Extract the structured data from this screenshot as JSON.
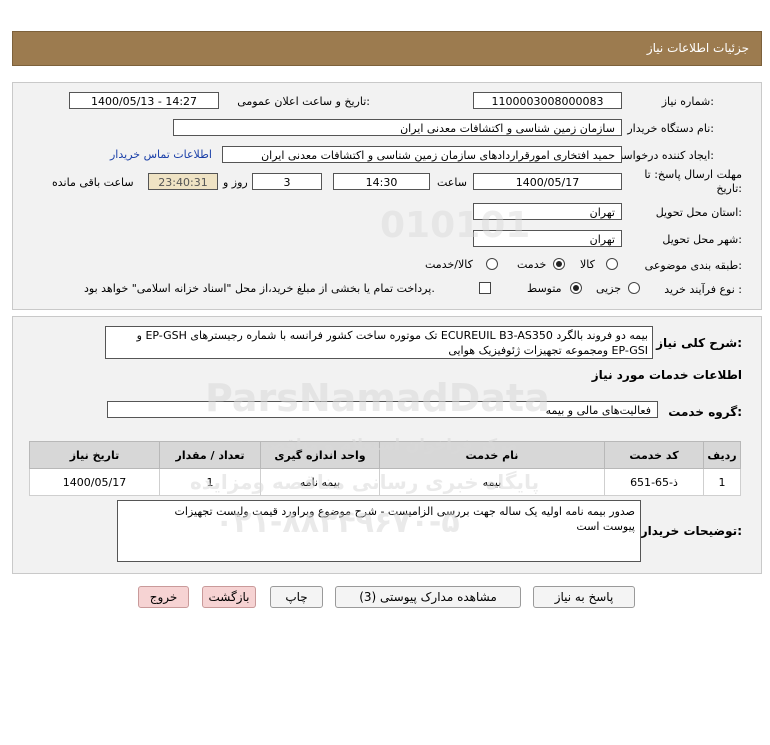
{
  "header": {
    "title": "جزئیات اطلاعات نیاز"
  },
  "form": {
    "need_number_label": "شماره نیاز:",
    "need_number": "1100003008000083",
    "announce_label": "تاریخ و ساعت اعلان عمومی:",
    "announce_value": "1400/05/13 - 14:27",
    "buyer_org_label": "نام دستگاه خریدار:",
    "buyer_org": "سازمان زمین شناسی و اکتشافات معدنی ایران",
    "requester_label": "ایجاد کننده درخواست:",
    "requester": "حمید افتخاری امورقراردادهای سازمان زمین شناسی و اکتشافات معدنی ایران",
    "contact_link": "اطلاعات تماس خریدار",
    "deadline_label": "مهلت ارسال پاسخ: تا تاریخ:",
    "deadline_date": "1400/05/17",
    "time_label": "ساعت",
    "deadline_time": "14:30",
    "days_value": "3",
    "days_label": "روز و",
    "remaining_time": "23:40:31",
    "remaining_label": "ساعت باقی مانده",
    "province_label": "استان محل تحویل:",
    "province": "تهران",
    "city_label": "شهر محل تحویل:",
    "city": "تهران",
    "category_label": "طبقه بندی موضوعی:",
    "category_options": [
      "کالا",
      "خدمت",
      "کالا/خدمت"
    ],
    "category_selected": "خدمت",
    "process_label": "نوع فرآیند خرید :",
    "process_options": [
      "جزیی",
      "متوسط"
    ],
    "process_selected": "متوسط",
    "payment_text": "پرداخت تمام یا بخشی از مبلغ خرید،از محل \"اسناد خزانه اسلامی\" خواهد بود."
  },
  "details": {
    "summary_label": "شرح کلی نیاز:",
    "summary_line1": "بیمه دو فروند بالگرد ECUREUIL B3-AS350 تک موتوره ساخت کشور فرانسه با شماره رجیسترهای EP-GSH و",
    "summary_line2": "EP-GSI ومجموعه تجهیزات ژئوفیزیک هوایی",
    "services_heading": "اطلاعات خدمات مورد نیاز",
    "service_group_label": "گروه خدمت:",
    "service_group": "فعالیت‌های مالی و بیمه",
    "table": {
      "headers": [
        "ردیف",
        "کد خدمت",
        "نام خدمت",
        "واحد اندازه گیری",
        "تعداد / مقدار",
        "تاریخ نیاز"
      ],
      "rows": [
        [
          "1",
          "ذ-65-651",
          "بیمه",
          "بیمه نامه",
          "1",
          "1400/05/17"
        ]
      ]
    },
    "buyer_notes_label": "توضیحات خریدار:",
    "buyer_notes_line1": "صدور بیمه نامه اولیه یک ساله جهت بررسی الزامیست - شرح موضوع وبراورد قیمت ولیست تجهیزات",
    "buyer_notes_line2": "پیوست است"
  },
  "buttons": {
    "reply": "پاسخ به نیاز",
    "attachments": "مشاهده مدارک پیوستی (3)",
    "print": "چاپ",
    "back": "بازگشت",
    "exit": "خروج"
  },
  "watermark": {
    "brand": "ParsNamadData",
    "tagline": "مرکز فراخوان استعلام و مناقصه",
    "tagline2": "پایگاه خبری رسانی مناقصه ومزایده",
    "phone": "۰۲۱-۸۸۳۴۹۶۷۰-۵"
  }
}
